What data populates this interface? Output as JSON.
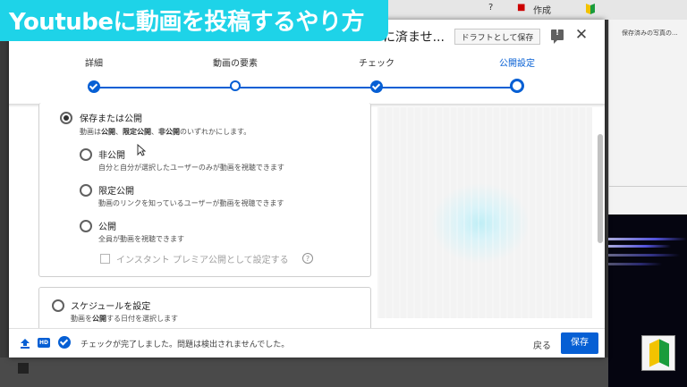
{
  "banner": {
    "text": "Youtubeに動画を投稿するやり方"
  },
  "background": {
    "top_bar_create": "作成",
    "right_panel_text": "保存済みの写真の..."
  },
  "dialog": {
    "title": "に済ませ...",
    "draft_button": "ドラフトとして保存",
    "feedback_icon": "!",
    "close_icon": "✕"
  },
  "stepper": {
    "steps": [
      {
        "label": "詳細",
        "state": "done"
      },
      {
        "label": "動画の要素",
        "state": "visited"
      },
      {
        "label": "チェック",
        "state": "done"
      },
      {
        "label": "公開設定",
        "state": "active"
      }
    ]
  },
  "visibility": {
    "title": "保存または公開",
    "subtitle_pre": "動画は",
    "subtitle_b1": "公開",
    "subtitle_sep1": "、",
    "subtitle_b2": "限定公開",
    "subtitle_sep2": "、",
    "subtitle_b3": "非公開",
    "subtitle_post": "のいずれかにします。",
    "options": [
      {
        "label": "非公開",
        "desc": "自分と自分が選択したユーザーのみが動画を視聴できます",
        "selected": false
      },
      {
        "label": "限定公開",
        "desc": "動画のリンクを知っているユーザーが動画を視聴できます",
        "selected": false
      },
      {
        "label": "公開",
        "desc": "全員が動画を視聴できます",
        "selected": false
      }
    ],
    "premiere_checkbox": "インスタント プレミア公開として設定する",
    "help_icon": "?"
  },
  "schedule": {
    "title": "スケジュールを設定",
    "subtitle_pre": "動画を",
    "subtitle_bold": "公開",
    "subtitle_post": "する日付を選択します"
  },
  "footer": {
    "hd_label": "HD",
    "status": "チェックが完了しました。問題は検出されませんでした。",
    "back_button": "戻る",
    "save_button": "保存"
  },
  "colors": {
    "accent": "#065fd4",
    "banner": "#1ed3e8"
  }
}
